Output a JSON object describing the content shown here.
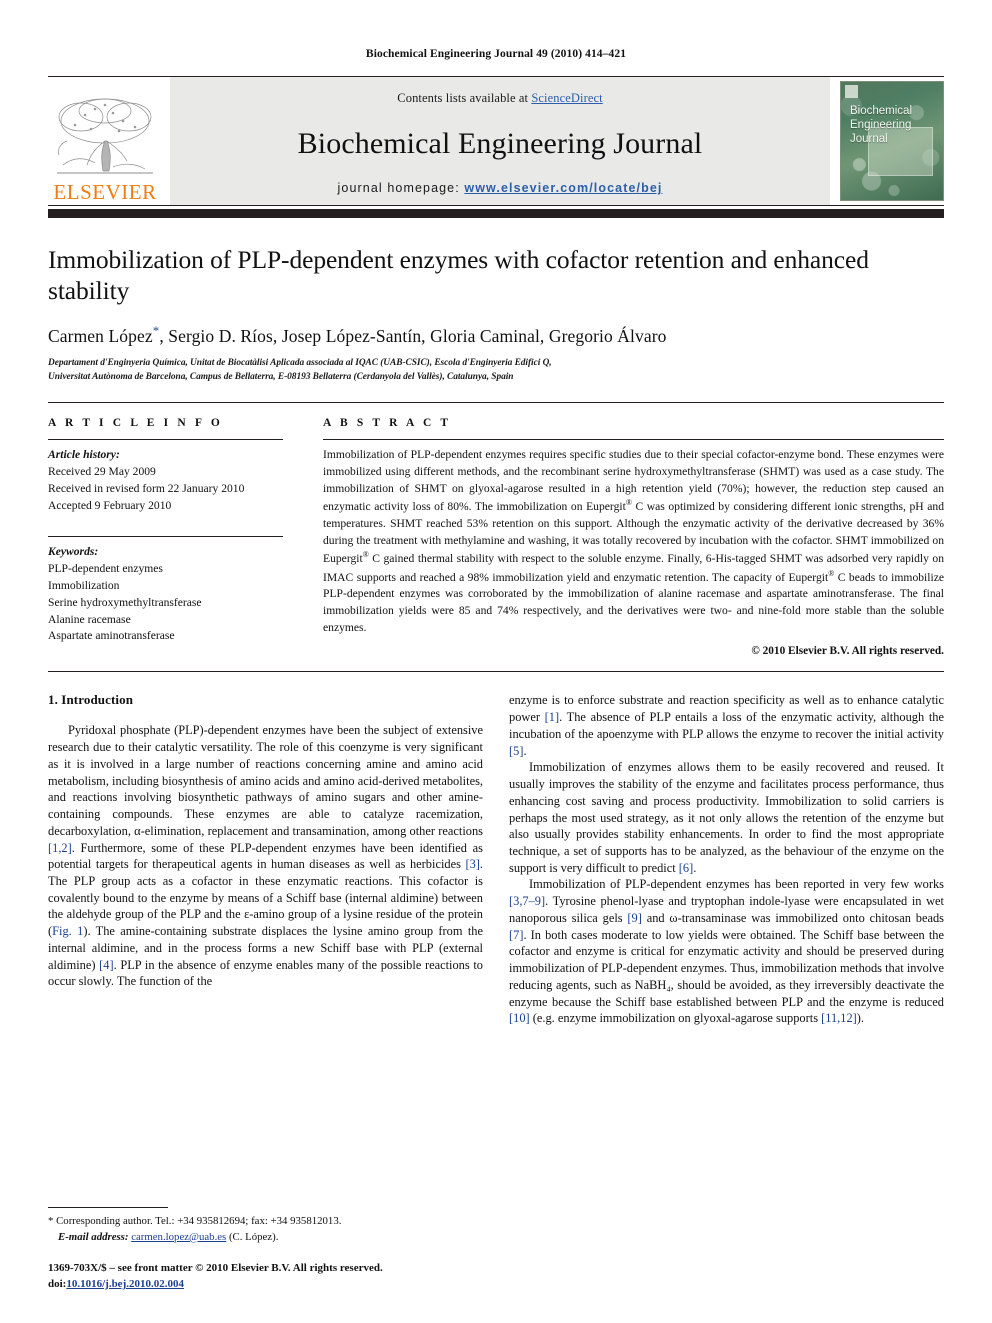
{
  "running_head": "Biochemical Engineering Journal 49 (2010) 414–421",
  "masthead": {
    "contents_prefix": "Contents lists available at ",
    "sciencedirect": "ScienceDirect",
    "journal_title": "Biochemical Engineering Journal",
    "homepage_label": "journal homepage:",
    "homepage_url": "www.elsevier.com/locate/bej",
    "elsevier_wordmark": "ELSEVIER",
    "elsevier_orange": "#f07c14",
    "link_blue": "#2b5faa",
    "cover_title_line1": "Biochemical",
    "cover_title_line2": "Engineering",
    "cover_title_line3": "Journal"
  },
  "title": "Immobilization of PLP-dependent enzymes with cofactor retention and enhanced stability",
  "authors": "Carmen López",
  "authors_rest": ", Sergio D. Ríos, Josep López-Santín, Gloria Caminal, Gregorio Álvaro",
  "corresponding_marker": "*",
  "affiliation_line1": "Departament d'Enginyeria Química, Unitat de Biocatàlisi Aplicada associada al IQAC (UAB-CSIC), Escola d'Enginyeria Edifici Q,",
  "affiliation_line2": "Universitat Autònoma de Barcelona, Campus de Bellaterra, E-08193 Bellaterra (Cerdanyola del Vallès), Catalunya, Spain",
  "article_info": {
    "heading": "A R T I C L E    I N F O",
    "history_label": "Article history:",
    "history": [
      "Received 29 May 2009",
      "Received in revised form 22 January 2010",
      "Accepted 9 February 2010"
    ],
    "keywords_label": "Keywords:",
    "keywords": [
      "PLP-dependent enzymes",
      "Immobilization",
      "Serine hydroxymethyltransferase",
      "Alanine racemase",
      "Aspartate aminotransferase"
    ]
  },
  "abstract": {
    "heading": "A B S T R A C T",
    "text_before_eupergit1": "Immobilization of PLP-dependent enzymes requires specific studies due to their special cofactor-enzyme bond. These enzymes were immobilized using different methods, and the recombinant serine hydroxymethyltransferase (SHMT) was used as a case study. The immobilization of SHMT on glyoxal-agarose resulted in a high retention yield (70%); however, the reduction step caused an enzymatic activity loss of 80%. The immobilization on Eupergit",
    "text_mid1": " C was optimized by considering different ionic strengths, pH and temperatures. SHMT reached 53% retention on this support. Although the enzymatic activity of the derivative decreased by 36% during the treatment with methylamine and washing, it was totally recovered by incubation with the cofactor. SHMT immobilized on Eupergit",
    "text_mid2": " C gained thermal stability with respect to the soluble enzyme. Finally, 6-His-tagged SHMT was adsorbed very rapidly on IMAC supports and reached a 98% immobilization yield and enzymatic retention. The capacity of Eupergit",
    "text_end": " C beads to immobilize PLP-dependent enzymes was corroborated by the immobilization of alanine racemase and aspartate aminotransferase. The final immobilization yields were 85 and 74% respectively, and the derivatives were two- and nine-fold more stable than the soluble enzymes.",
    "registered_mark": "®",
    "copyright": "© 2010 Elsevier B.V. All rights reserved."
  },
  "body": {
    "section_title": "1. Introduction",
    "left_paragraphs": [
      {
        "segments": [
          {
            "t": "Pyridoxal phosphate (PLP)-dependent enzymes have been the subject of extensive research due to their catalytic versatility. The role of this coenzyme is very significant as it is involved in a large number of reactions concerning amine and amino acid metabolism, including biosynthesis of amino acids and amino acid-derived metabolites, and reactions involving biosynthetic pathways of amino sugars and other amine-containing compounds. These enzymes are able to catalyze racemization, decarboxylation, α-elimination, replacement and transamination, among other reactions "
          },
          {
            "t": "[1,2]",
            "ref": true
          },
          {
            "t": ". Furthermore, some of these PLP-dependent enzymes have been identified as potential targets for therapeutical agents in human diseases as well as herbicides "
          },
          {
            "t": "[3]",
            "ref": true
          },
          {
            "t": ". The PLP group acts as a cofactor in these enzymatic reactions. This cofactor is covalently bound to the enzyme by means of a Schiff base (internal aldimine) between the aldehyde group of the PLP and the ε-amino group of a lysine residue of the protein ("
          },
          {
            "t": "Fig. 1",
            "ref": true
          },
          {
            "t": "). The amine-containing substrate displaces the lysine amino group from the internal aldimine, and in the process forms a new Schiff base with PLP (external aldimine) "
          },
          {
            "t": "[4]",
            "ref": true
          },
          {
            "t": ". PLP in the absence of enzyme enables many of the possible reactions to occur slowly. The function of the"
          }
        ]
      }
    ],
    "right_paragraphs": [
      {
        "no_indent": true,
        "segments": [
          {
            "t": "enzyme is to enforce substrate and reaction specificity as well as to enhance catalytic power "
          },
          {
            "t": "[1]",
            "ref": true
          },
          {
            "t": ". The absence of PLP entails a loss of the enzymatic activity, although the incubation of the apoenzyme with PLP allows the enzyme to recover the initial activity "
          },
          {
            "t": "[5]",
            "ref": true
          },
          {
            "t": "."
          }
        ]
      },
      {
        "segments": [
          {
            "t": "Immobilization of enzymes allows them to be easily recovered and reused. It usually improves the stability of the enzyme and facilitates process performance, thus enhancing cost saving and process productivity. Immobilization to solid carriers is perhaps the most used strategy, as it not only allows the retention of the enzyme but also usually provides stability enhancements. In order to find the most appropriate technique, a set of supports has to be analyzed, as the behaviour of the enzyme on the support is very difficult to predict "
          },
          {
            "t": "[6]",
            "ref": true
          },
          {
            "t": "."
          }
        ]
      },
      {
        "segments": [
          {
            "t": "Immobilization of PLP-dependent enzymes has been reported in very few works "
          },
          {
            "t": "[3,7–9]",
            "ref": true
          },
          {
            "t": ". Tyrosine phenol-lyase and tryptophan indole-lyase were encapsulated in wet nanoporous silica gels "
          },
          {
            "t": "[9]",
            "ref": true
          },
          {
            "t": " and ω-transaminase was immobilized onto chitosan beads "
          },
          {
            "t": "[7]",
            "ref": true
          },
          {
            "t": ". In both cases moderate to low yields were obtained. The Schiff base between the cofactor and enzyme is critical for enzymatic activity and should be preserved during immobilization of PLP-dependent enzymes. Thus, immobilization methods that involve reducing agents, such as NaBH₄, should be avoided, as they irreversibly deactivate the enzyme because the Schiff base established between PLP and the enzyme is reduced "
          },
          {
            "t": "[10]",
            "ref": true
          },
          {
            "t": " (e.g. enzyme immobilization on glyoxal-agarose supports "
          },
          {
            "t": "[11,12]",
            "ref": true
          },
          {
            "t": ")."
          }
        ]
      }
    ]
  },
  "footnote": {
    "corresponding": "* Corresponding author. Tel.: +34 935812694; fax: +34 935812013.",
    "email_label": "E-mail address:",
    "email": "carmen.lopez@uab.es",
    "email_suffix": " (C. López)."
  },
  "imprint": {
    "line1": "1369-703X/$ – see front matter © 2010 Elsevier B.V. All rights reserved.",
    "doi_label": "doi:",
    "doi": "10.1016/j.bej.2010.02.004"
  }
}
